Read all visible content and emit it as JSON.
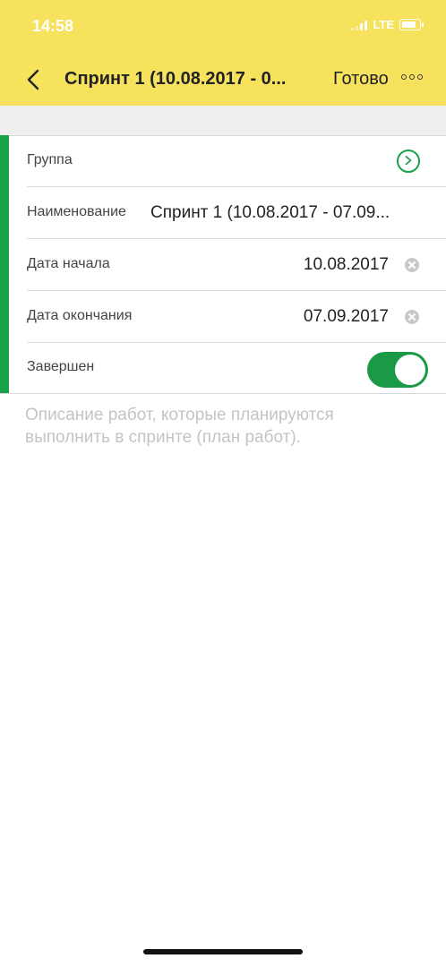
{
  "status_bar": {
    "time": "14:58",
    "network": "LTE"
  },
  "nav": {
    "title": "Спринт 1 (10.08.2017 - 0...",
    "done_label": "Готово"
  },
  "form": {
    "group_label": "Группа",
    "name_label": "Наименование",
    "name_value": "Спринт 1 (10.08.2017 - 07.09...",
    "start_label": "Дата начала",
    "start_value": "10.08.2017",
    "end_label": "Дата окончания",
    "end_value": "07.09.2017",
    "completed_label": "Завершен",
    "completed": true
  },
  "description_placeholder": "Описание работ, которые планируются выполнить в спринте (план работ).",
  "colors": {
    "header": "#f7e25e",
    "accent": "#1aa04a",
    "toggle_on": "#1a9a45"
  }
}
